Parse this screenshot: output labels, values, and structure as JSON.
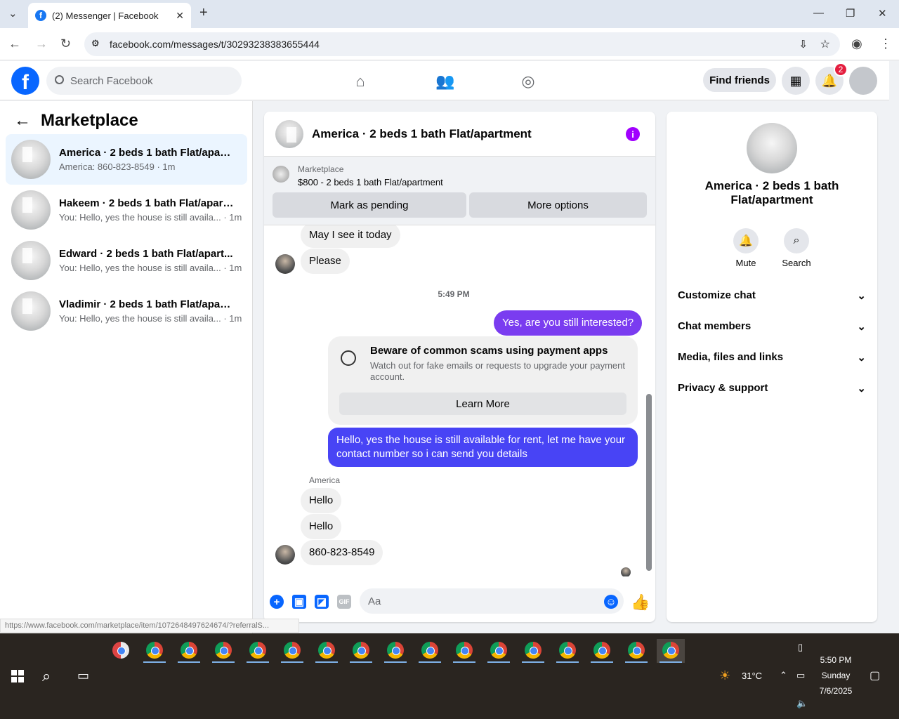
{
  "browser": {
    "tab_title": "(2) Messenger | Facebook",
    "url": "facebook.com/messages/t/30293238383655444",
    "status_url": "https://www.facebook.com/marketplace/item/1072648497624674/?referralS..."
  },
  "header": {
    "search_placeholder": "Search Facebook",
    "find_friends": "Find friends",
    "notification_count": "2"
  },
  "sidebar": {
    "title": "Marketplace",
    "conversations": [
      {
        "name": "America · 2 beds 1 bath Flat/apart...",
        "preview": "America: 860-823-8549 · 1m"
      },
      {
        "name": "Hakeem · 2 beds 1 bath Flat/apart...",
        "preview": "You: Hello, yes the house is still availa... · 1m"
      },
      {
        "name": "Edward · 2 beds 1 bath Flat/apart...",
        "preview": "You: Hello, yes the house is still availa... · 1m"
      },
      {
        "name": "Vladimir · 2 beds 1 bath Flat/apart...",
        "preview": "You: Hello, yes the house is still availa... · 1m"
      }
    ]
  },
  "chat": {
    "title": "America · 2 beds 1 bath Flat/apartment",
    "listing_label": "Marketplace",
    "listing_desc": "$800 - 2 beds 1 bath Flat/apartment",
    "mark_pending": "Mark as pending",
    "more_options": "More options",
    "messages": {
      "m1": "May I see it today",
      "m2": "Please",
      "time": "5:49 PM",
      "m3": "Yes, are you still interested?",
      "scam_title": "Beware of common scams using payment apps",
      "scam_desc": "Watch out for fake emails or requests to upgrade your payment account.",
      "learn_more": "Learn More",
      "m4": "Hello, yes the house is still available for rent, let me have your contact number so i can send you details",
      "sender": "America",
      "m5": "Hello",
      "m6": "Hello",
      "m7": "860-823-8549"
    },
    "input_placeholder": "Aa"
  },
  "details": {
    "title": "America · 2 beds 1 bath Flat/apartment",
    "mute": "Mute",
    "search": "Search",
    "sections": [
      "Customize chat",
      "Chat members",
      "Media, files and links",
      "Privacy & support"
    ]
  },
  "taskbar": {
    "weather": "31°C",
    "time": "5:50 PM",
    "day": "Sunday",
    "date": "7/6/2025"
  },
  "colors": {
    "fb_blue": "#0866ff",
    "outgoing_purple": "#7a3cf0",
    "outgoing_blue": "#4844f5",
    "active_conv": "#ebf5ff",
    "notification_red": "#e41e3f"
  }
}
